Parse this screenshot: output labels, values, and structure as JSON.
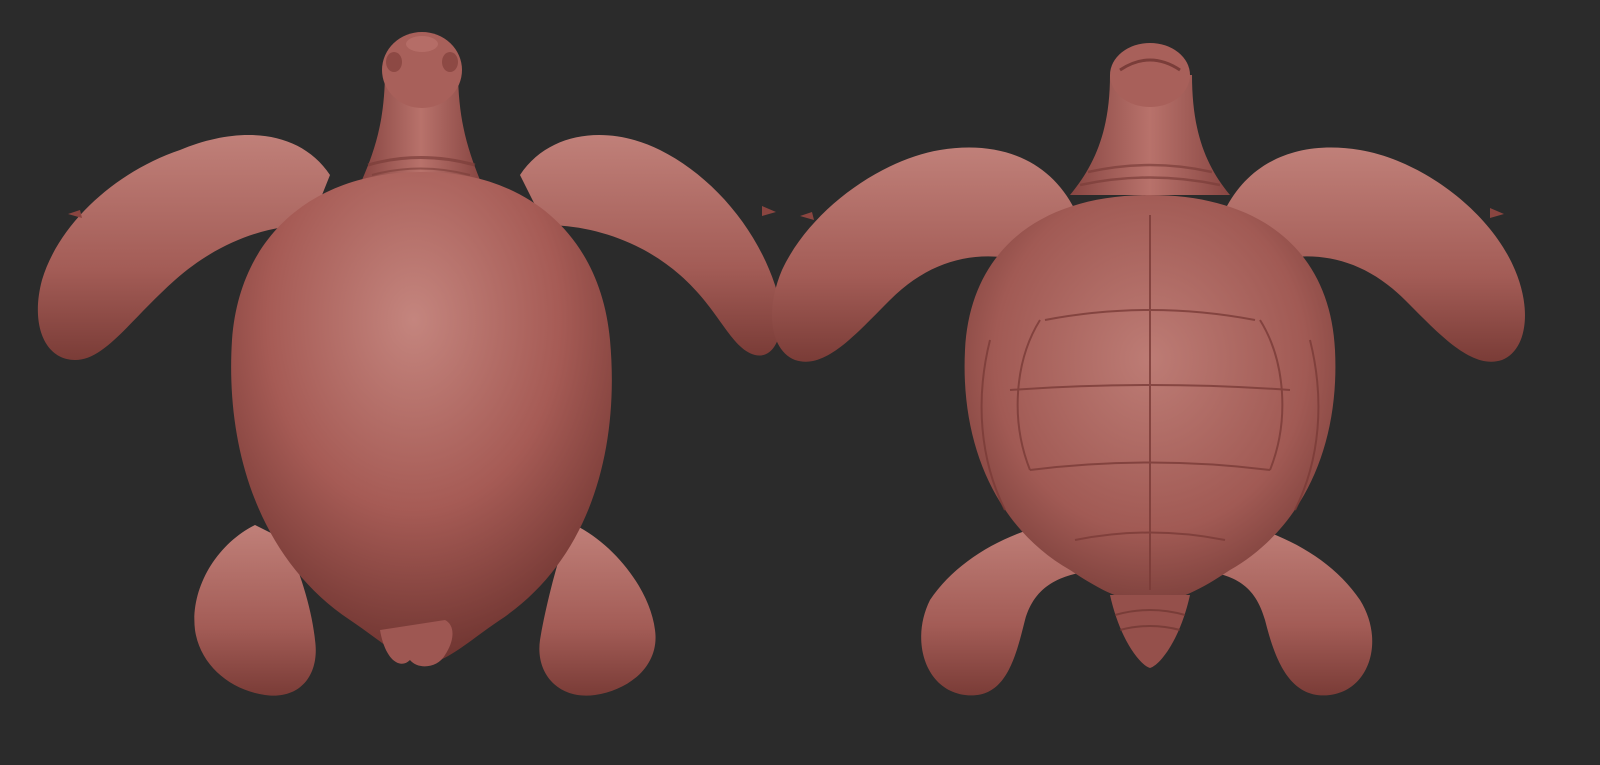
{
  "scene": {
    "background_color": "#2b2b2b",
    "clay_color": "#a65b55",
    "clay_highlight": "#c98780",
    "clay_shadow": "#6e3430",
    "views": [
      {
        "id": "dorsal",
        "description_name": "turtle-dorsal-view"
      },
      {
        "id": "ventral",
        "description_name": "turtle-ventral-view"
      }
    ]
  }
}
